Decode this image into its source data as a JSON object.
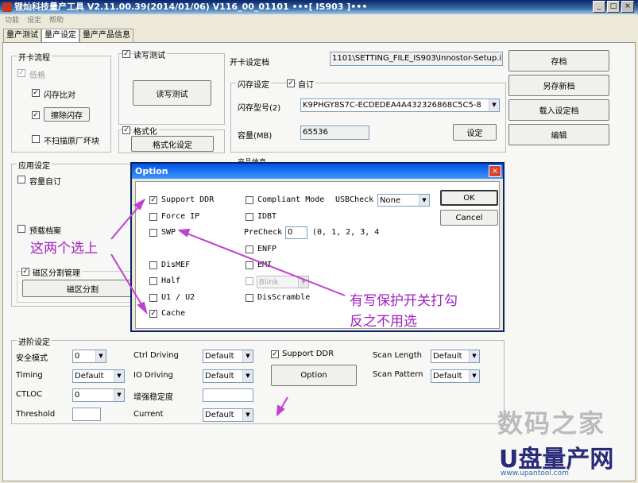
{
  "window": {
    "title": "锂灿科技量产工具 V2.11.00.39(2014/01/06)    V116_00_01101               •••[ IS903 ]•••",
    "min": "_",
    "max": "□",
    "close": "×"
  },
  "menu": [
    "功能",
    "设定",
    "帮助"
  ],
  "tabs": [
    "量产测试",
    "量产设定",
    "量产产品信息"
  ],
  "card_flow": {
    "legend": "开卡流程",
    "low_format": "低格",
    "flash_compare": "闪存比对",
    "erase_flash": "擦除闪存",
    "no_scan_bad": "不扫描原厂坏块"
  },
  "rw_test": {
    "checkbox": "读写测试",
    "button": "读写测试"
  },
  "format": {
    "checkbox": "格式化",
    "button": "格式化设定"
  },
  "setting_file": {
    "label": "开卡设定档",
    "value": "1101\\SETTING_FILE_IS903\\Innostor-Setup.ini"
  },
  "flash_setting": {
    "legend": "闪存设定",
    "custom": "自订",
    "type_label": "闪存型号(2)",
    "type_value": "K9PHGY8S7C-ECDEDEA4A432326868C5C5-8",
    "cap_label": "容量(MB)",
    "cap_value": "65536",
    "set_btn": "设定"
  },
  "right_buttons": [
    "存档",
    "另存新档",
    "载入设定档",
    "编辑"
  ],
  "app_setting": {
    "legend": "应用设定",
    "capacity_custom": "容量自订",
    "preload": "预载档案",
    "partition": "磁区分割管理",
    "partition_btn": "磁区分割"
  },
  "product_info_legend": "产品信息",
  "advanced": {
    "legend": "进阶设定",
    "safe_mode": "安全模式",
    "safe_val": "0",
    "timing": "Timing",
    "timing_val": "Default",
    "ctloc": "CTLOC",
    "ctloc_val": "0",
    "threshold": "Threshold",
    "ctrl_driving": "Ctrl Driving",
    "ctrl_val": "Default",
    "io_driving": "IO Driving",
    "io_val": "Default",
    "enhance": "增强稳定度",
    "current": "Current",
    "current_val": "Default",
    "support_ddr": "Support DDR",
    "option_btn": "Option",
    "scan_length": "Scan Length",
    "scan_length_val": "Default",
    "scan_pattern": "Scan Pattern",
    "scan_pattern_val": "Default"
  },
  "option_dialog": {
    "title": "Option",
    "close": "×",
    "support_ddr": "Support DDR",
    "force_ip": "Force IP",
    "swp": "SWP",
    "dismef": "DisMEF",
    "half": "Half",
    "u1u2": "U1 / U2",
    "cache": "Cache",
    "compliant": "Compliant Mode",
    "usbcheck": "USBCheck",
    "usbcheck_val": "None",
    "idbt": "IDBT",
    "precheck": "PreCheck",
    "precheck_val": "0",
    "precheck_opts": "(0, 1, 2, 3, 4",
    "enfp": "ENFP",
    "emi": "EMI",
    "blink": "Blink",
    "disscramble": "DisScramble",
    "ok": "OK",
    "cancel": "Cancel"
  },
  "annotations": {
    "left": "这两个选上",
    "right1": "有写保护开关打勾",
    "right2": "反之不用选"
  },
  "watermark": {
    "line1": "数码之家",
    "line2": "U盘量产网",
    "line3": "www.upantool.com"
  },
  "colors": {
    "annotation": "#A020C0",
    "title_bar": "#0A246A"
  }
}
